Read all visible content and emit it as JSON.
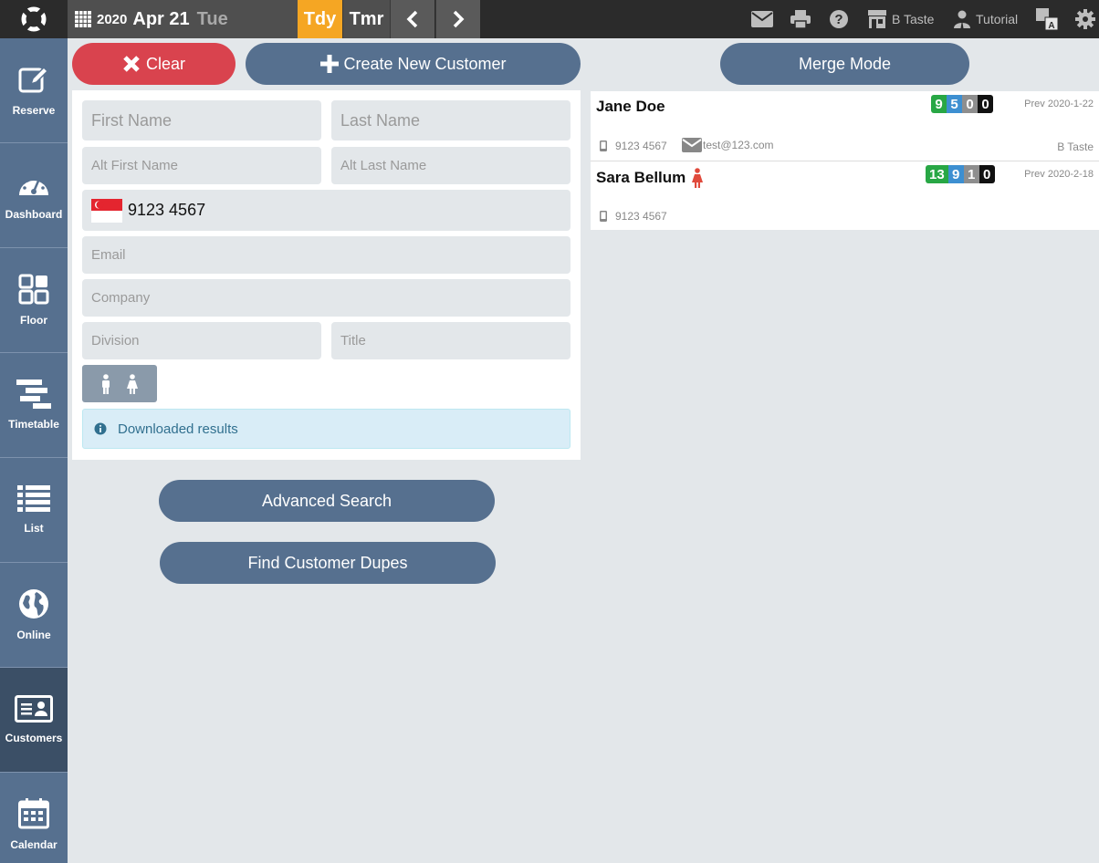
{
  "topbar": {
    "year": "2020",
    "month_day": "Apr 21",
    "weekday": "Tue",
    "today_label": "Tdy",
    "tomorrow_label": "Tmr",
    "restaurant": "B Taste",
    "tutorial": "Tutorial"
  },
  "sidebar": {
    "items": [
      {
        "label": "Reserve",
        "icon": "pencil-square-icon"
      },
      {
        "label": "Dashboard",
        "icon": "gauge-icon"
      },
      {
        "label": "Floor",
        "icon": "grid-icon"
      },
      {
        "label": "Timetable",
        "icon": "timetable-icon"
      },
      {
        "label": "List",
        "icon": "list-icon"
      },
      {
        "label": "Online",
        "icon": "globe-icon"
      },
      {
        "label": "Customers",
        "icon": "id-card-icon"
      },
      {
        "label": "Calendar",
        "icon": "calendar-icon"
      }
    ],
    "active": "Customers"
  },
  "actions": {
    "clear": "Clear",
    "create": "Create New Customer",
    "merge": "Merge Mode",
    "advanced_search": "Advanced Search",
    "find_dupes": "Find Customer Dupes"
  },
  "form": {
    "first_name": "First Name",
    "last_name": "Last Name",
    "alt_first_name": "Alt First Name",
    "alt_last_name": "Alt Last Name",
    "phone": "9123 4567",
    "email": "Email",
    "company": "Company",
    "division": "Division",
    "title": "Title",
    "info": "Downloaded results"
  },
  "results": [
    {
      "name": "Jane Doe",
      "badges": [
        "9",
        "5",
        "0",
        "0"
      ],
      "prev": "Prev 2020-1-22",
      "phone": "9123 4567",
      "email": "test@123.com",
      "location": "B Taste"
    },
    {
      "name": "Sara Bellum",
      "badges": [
        "13",
        "9",
        "1",
        "0"
      ],
      "prev": "Prev 2020-2-18",
      "phone": "9123 4567"
    }
  ],
  "colors": {
    "accent": "#f5a623",
    "sidebar": "#56708f",
    "danger": "#d9434e",
    "badge_green": "#28a745",
    "badge_blue": "#3d8fd1",
    "badge_gray": "#8e8e8e",
    "badge_black": "#111111"
  }
}
